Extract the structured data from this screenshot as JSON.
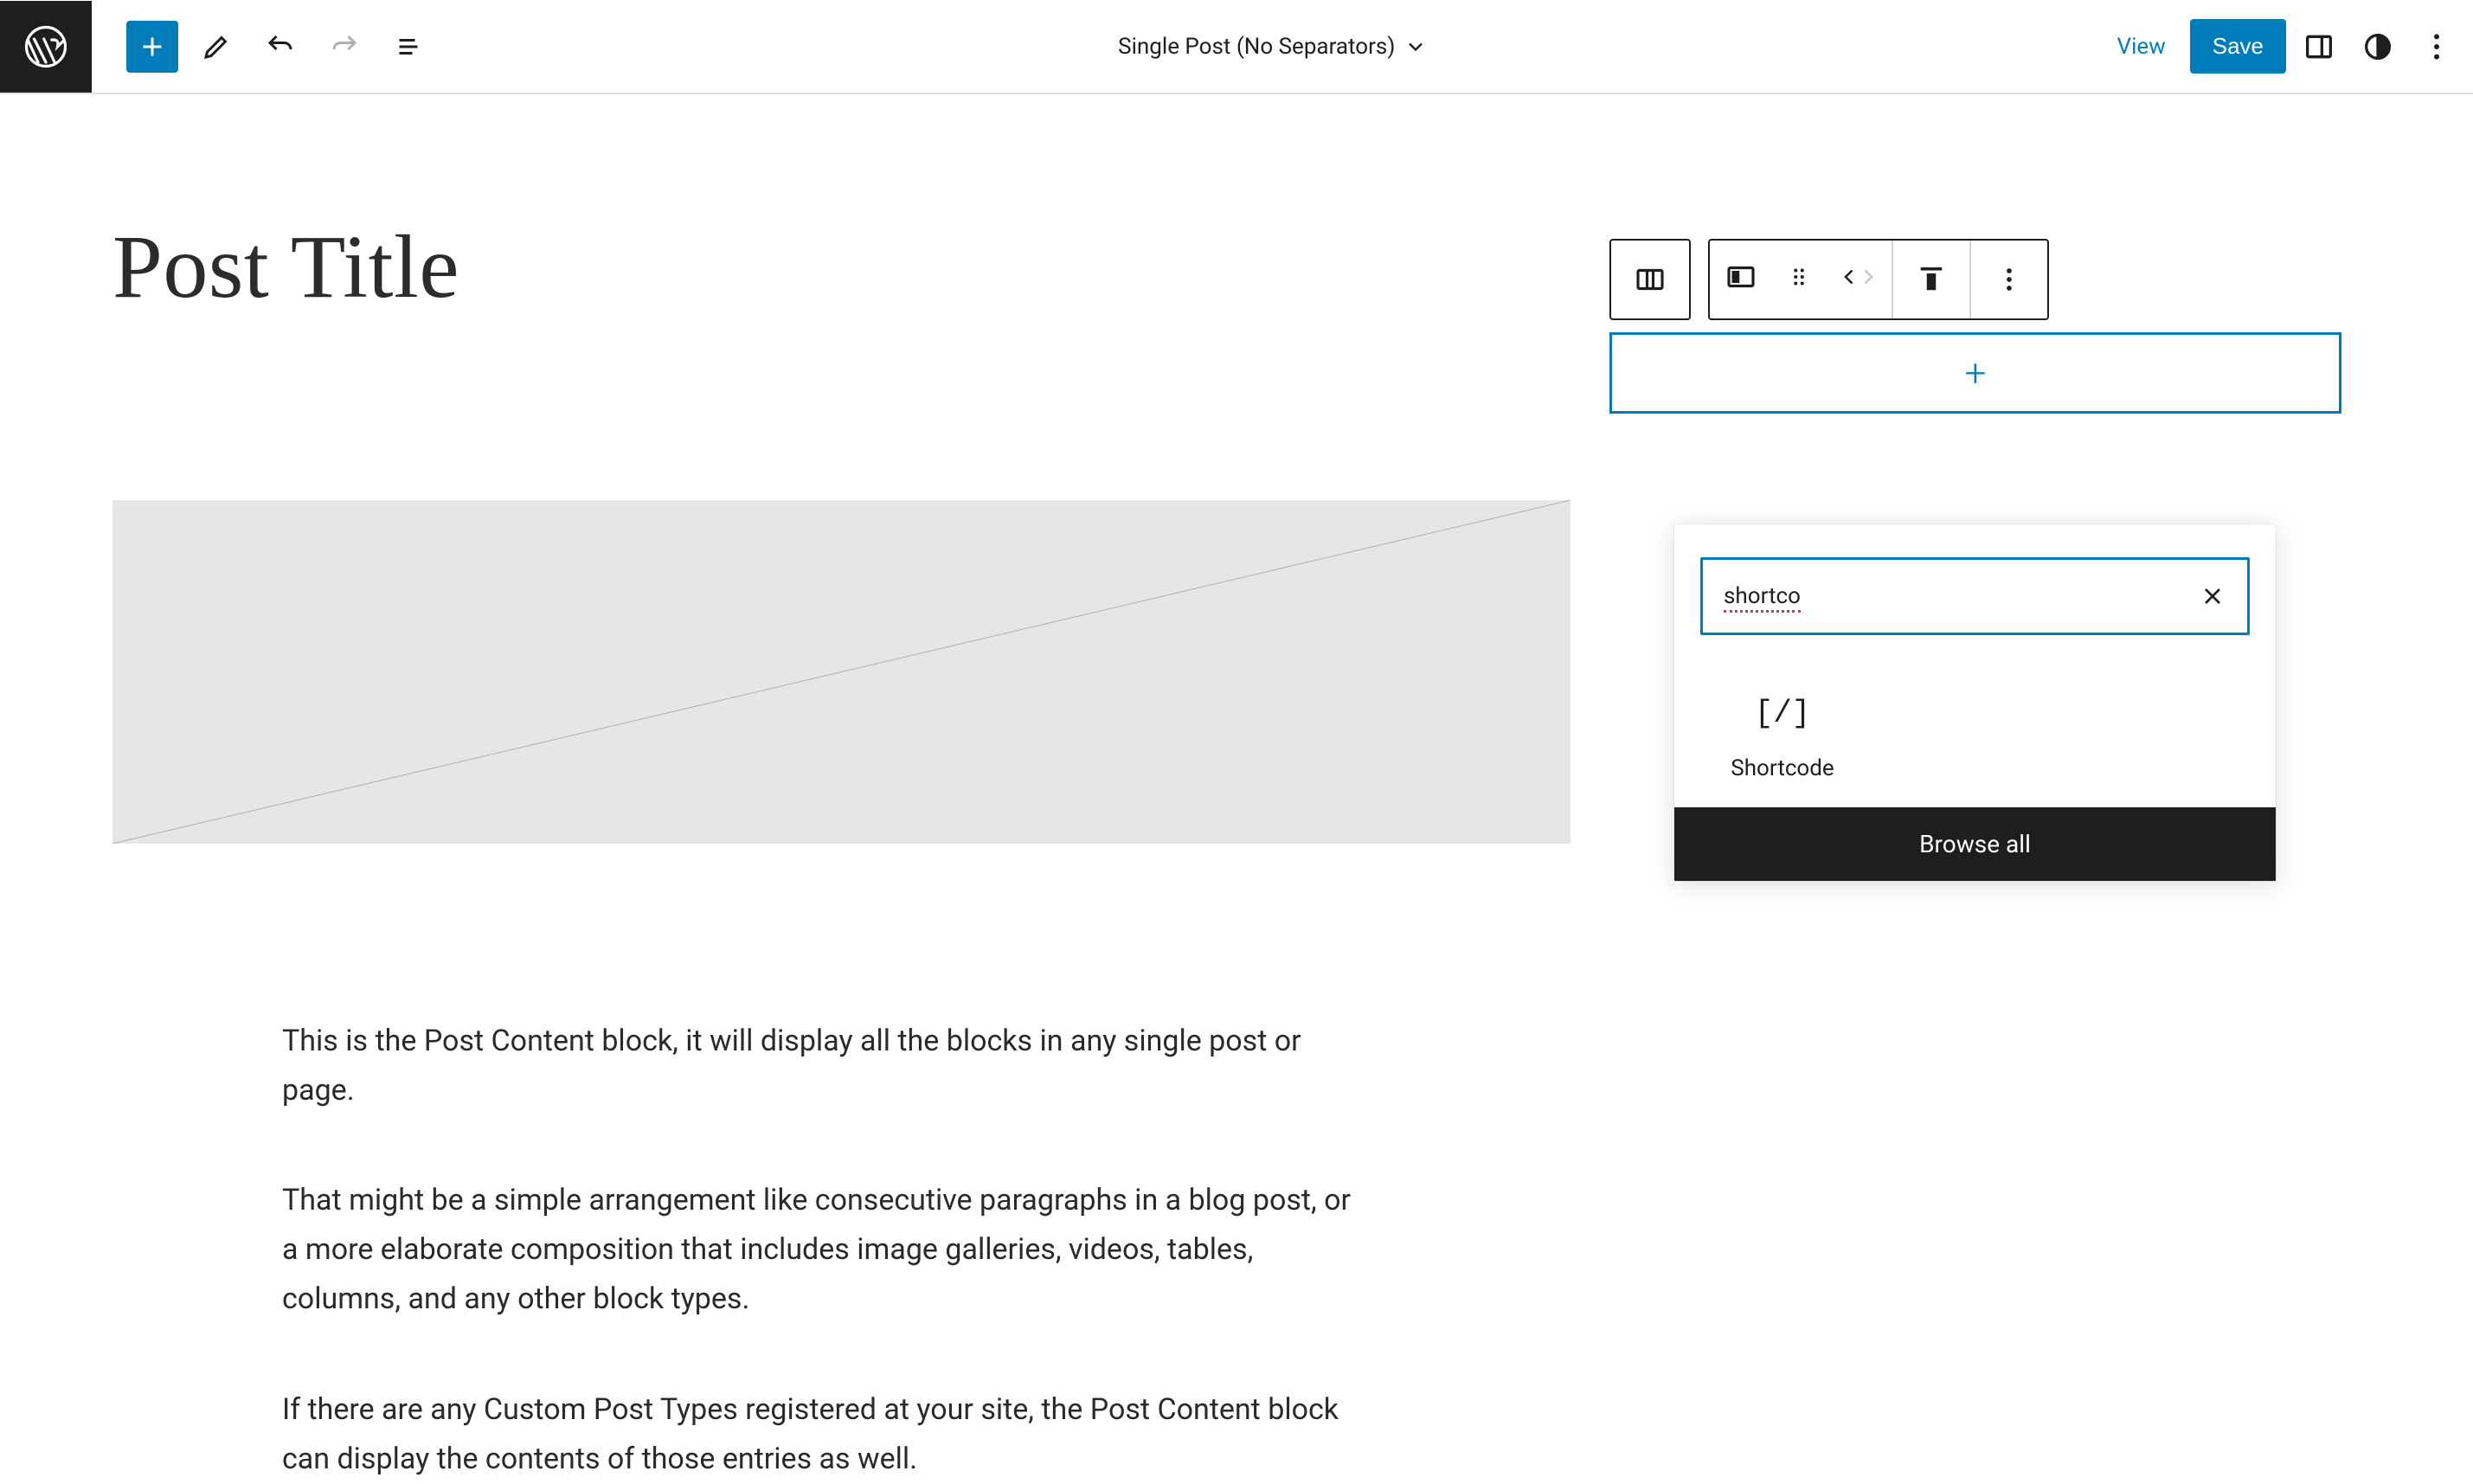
{
  "topbar": {
    "template_label": "Single Post (No Separators)",
    "view_label": "View",
    "save_label": "Save"
  },
  "post": {
    "title": "Post Title",
    "paragraphs": [
      "This is the Post Content block, it will display all the blocks in any single post or page.",
      "That might be a simple arrangement like consecutive paragraphs in a blog post, or a more elaborate composition that includes image galleries, videos, tables, columns, and any other block types.",
      "If there are any Custom Post Types registered at your site, the Post Content block can display the contents of those entries as well."
    ]
  },
  "inserter": {
    "search_value": "shortco",
    "results": [
      {
        "icon": "[/]",
        "label": "Shortcode"
      }
    ],
    "browse_all_label": "Browse all"
  },
  "colors": {
    "accent": "#007cba",
    "text": "#1e1e1e"
  }
}
